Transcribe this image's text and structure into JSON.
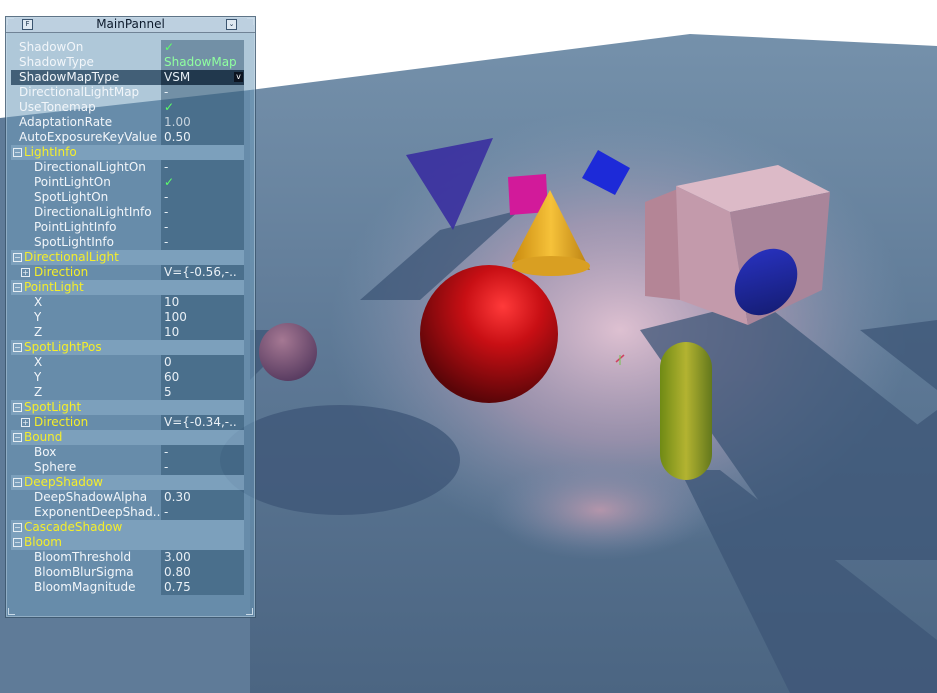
{
  "panel": {
    "title": "MainPannel",
    "rows": [
      {
        "kind": "top",
        "label": "ShadowOn",
        "value": "✓",
        "vclass": "check"
      },
      {
        "kind": "top",
        "label": "ShadowType",
        "value": "ShadowMap",
        "vclass": "green"
      },
      {
        "kind": "top",
        "label": "ShadowMapType",
        "value": "VSM",
        "vclass": "sel",
        "dropdown": true,
        "selected": true
      },
      {
        "kind": "top",
        "label": "DirectionalLightMap",
        "value": "-",
        "vclass": ""
      },
      {
        "kind": "top",
        "label": "UseTonemap",
        "value": "✓",
        "vclass": "check"
      },
      {
        "kind": "top",
        "label": "AdaptationRate",
        "value": "1.00",
        "vclass": "gray"
      },
      {
        "kind": "top",
        "label": "AutoExposureKeyValue",
        "value": "0.50",
        "vclass": ""
      },
      {
        "kind": "sec",
        "label": "LightInfo",
        "toggle": "−"
      },
      {
        "kind": "sub",
        "label": "DirectionalLightOn",
        "value": "-",
        "vclass": ""
      },
      {
        "kind": "sub",
        "label": "PointLightOn",
        "value": "✓",
        "vclass": "check"
      },
      {
        "kind": "sub",
        "label": "SpotLightOn",
        "value": "-",
        "vclass": ""
      },
      {
        "kind": "sub",
        "label": "DirectionalLightInfo",
        "value": "-",
        "vclass": ""
      },
      {
        "kind": "sub",
        "label": "PointLightInfo",
        "value": "-",
        "vclass": ""
      },
      {
        "kind": "sub",
        "label": "SpotLightInfo",
        "value": "-",
        "vclass": ""
      },
      {
        "kind": "sec",
        "label": "DirectionalLight",
        "toggle": "−"
      },
      {
        "kind": "subsec",
        "label": "Direction",
        "value": "V={-0.56,-..",
        "toggle": "+"
      },
      {
        "kind": "sec",
        "label": "PointLight",
        "toggle": "−"
      },
      {
        "kind": "sub",
        "label": "X",
        "value": "10",
        "vclass": ""
      },
      {
        "kind": "sub",
        "label": "Y",
        "value": "100",
        "vclass": ""
      },
      {
        "kind": "sub",
        "label": "Z",
        "value": "10",
        "vclass": ""
      },
      {
        "kind": "sec",
        "label": "SpotLightPos",
        "toggle": "−"
      },
      {
        "kind": "sub",
        "label": "X",
        "value": "0",
        "vclass": ""
      },
      {
        "kind": "sub",
        "label": "Y",
        "value": "60",
        "vclass": ""
      },
      {
        "kind": "sub",
        "label": "Z",
        "value": "5",
        "vclass": ""
      },
      {
        "kind": "sec",
        "label": "SpotLight",
        "toggle": "−"
      },
      {
        "kind": "subsec",
        "label": "Direction",
        "value": "V={-0.34,-..",
        "toggle": "+"
      },
      {
        "kind": "sec",
        "label": "Bound",
        "toggle": "−"
      },
      {
        "kind": "sub",
        "label": "Box",
        "value": "-",
        "vclass": ""
      },
      {
        "kind": "sub",
        "label": "Sphere",
        "value": "-",
        "vclass": ""
      },
      {
        "kind": "sec",
        "label": "DeepShadow",
        "toggle": "−"
      },
      {
        "kind": "sub",
        "label": "DeepShadowAlpha",
        "value": "0.30",
        "vclass": ""
      },
      {
        "kind": "sub",
        "label": "ExponentDeepShad..",
        "value": "-",
        "vclass": ""
      },
      {
        "kind": "sec",
        "label": "CascadeShadow",
        "toggle": "−"
      },
      {
        "kind": "sec",
        "label": "Bloom",
        "toggle": "−"
      },
      {
        "kind": "sub",
        "label": "BloomThreshold",
        "value": "3.00",
        "vclass": ""
      },
      {
        "kind": "sub",
        "label": "BloomBlurSigma",
        "value": "0.80",
        "vclass": ""
      },
      {
        "kind": "sub",
        "label": "BloomMagnitude",
        "value": "0.75",
        "vclass": ""
      }
    ]
  },
  "colors": {
    "section_label": "#f5ee2a",
    "check": "#5cff6a",
    "floor": "#4d6a86"
  }
}
